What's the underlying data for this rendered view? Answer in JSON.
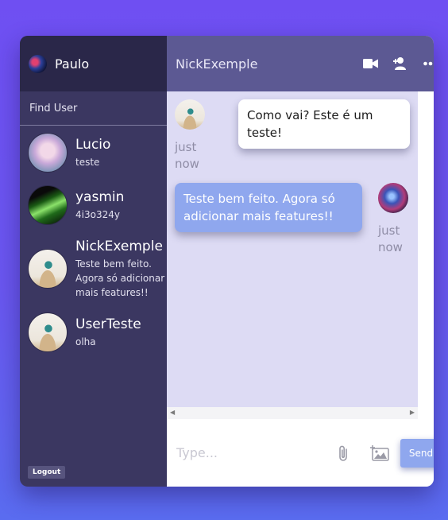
{
  "sidebar": {
    "current_user": "Paulo",
    "find_user": "Find User",
    "chats": [
      {
        "name": "Lucio",
        "preview": "teste"
      },
      {
        "name": "yasmin",
        "preview": "4i3o324y"
      },
      {
        "name": "NickExemple",
        "preview": "Teste bem feito. Agora só adicionar mais features!!"
      },
      {
        "name": "UserTeste",
        "preview": "olha"
      }
    ],
    "logout_label": "Logout"
  },
  "header": {
    "title": "NickExemple",
    "icons": [
      "video-camera-icon",
      "add-user-icon",
      "more-options-icon"
    ]
  },
  "messages": [
    {
      "direction": "incoming",
      "text": "Como vai? Este é um teste!",
      "time_line1": "just",
      "time_line2": "now"
    },
    {
      "direction": "outgoing",
      "text": "Teste bem feito. Agora só adicionar mais features!!",
      "time_line1": "just",
      "time_line2": "now"
    }
  ],
  "composer": {
    "placeholder": "Type...",
    "send_label": "Send"
  },
  "colors": {
    "sidebar_bg": "#3b3761",
    "sidebar_top": "#2a2749",
    "header_bg": "#5c5993",
    "chat_bg": "#dddbf4",
    "accent": "#8fa7ee"
  }
}
